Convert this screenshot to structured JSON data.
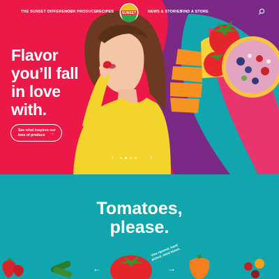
{
  "nav": {
    "links": [
      "THE SUNSET DIFFERENCE",
      "OUR PRODUCE",
      "RECIPES",
      "NEWS & STORIES",
      "FIND A STORE"
    ],
    "logo_text": "SUNSET",
    "search_icon": "search-icon"
  },
  "hero": {
    "headline_lines": [
      "Flavor",
      "you’ll fall",
      "in love",
      "with."
    ],
    "cta_line1": "See what inspires our",
    "cta_line2": "love of produce",
    "cta_arrow": "→",
    "carousel": {
      "prev": "‹",
      "next": "›",
      "dots": 4,
      "active_dot": 1
    }
  },
  "section": {
    "title_line1": "Tomatoes,",
    "title_line2": "please.",
    "tagline": "Vine ripened, hand picked, mind blown.",
    "prev": "←",
    "next": "→",
    "products": [
      "strawberry-icon",
      "cucumber-icon",
      "tomato-icon",
      "pepper-icon",
      "cherry-tomato-icon"
    ]
  },
  "colors": {
    "hero_red": "#ec1848",
    "teal": "#11a6ae",
    "purple": "#7a2a86",
    "yellow_shirt": "#f2d42a"
  }
}
